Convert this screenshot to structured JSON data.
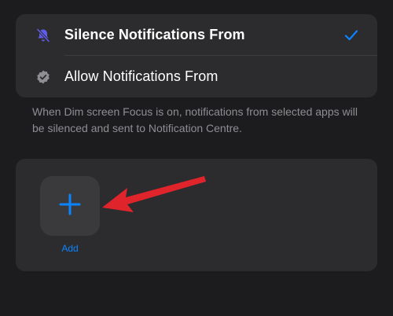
{
  "options": {
    "silence": {
      "label": "Silence Notifications From",
      "icon": "bell-slash-icon",
      "selected": true
    },
    "allow": {
      "label": "Allow Notifications From",
      "icon": "verified-badge-icon",
      "selected": false
    }
  },
  "description": "When Dim screen Focus is on, notifications from selected apps will be silenced and sent to Notification Centre.",
  "apps": {
    "add_label": "Add",
    "add_icon": "plus-icon"
  },
  "annotation": {
    "icon": "red-arrow-pointer-icon",
    "color": "#e0242b"
  },
  "colors": {
    "background": "#1c1c1e",
    "card": "#2c2c2e",
    "accent": "#0a84ff",
    "secondary_text": "#8e8e93",
    "silence_icon": "#5e5ce6"
  }
}
